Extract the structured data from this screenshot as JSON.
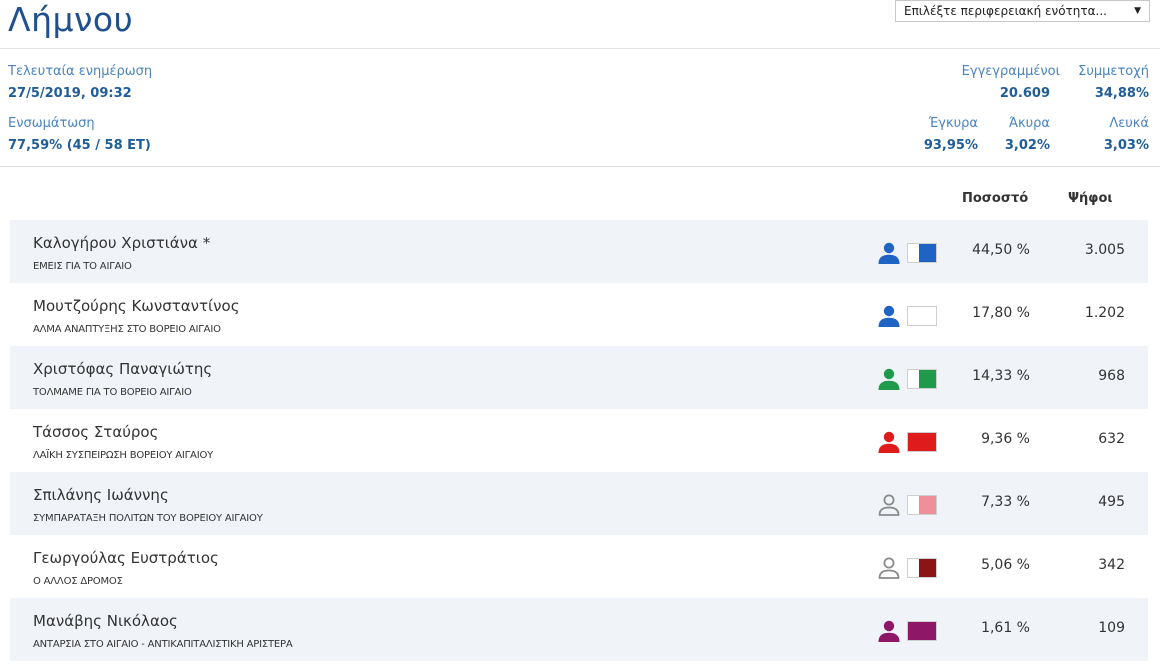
{
  "header": {
    "title": "Λήμνου",
    "region_select": {
      "value": "Επιλέξτε περιφερειακή ενότητα..."
    }
  },
  "meta": {
    "last_update_label": "Τελευταία ενημέρωση",
    "last_update_value": "27/5/2019, 09:32",
    "integration_label": "Ενσωμάτωση",
    "integration_pct": "77,59%",
    "integration_count": "(45 / 58 ΕΤ)",
    "registered_label": "Εγγεγραμμένοι",
    "registered_value": "20.609",
    "turnout_label": "Συμμετοχή",
    "turnout_value": "34,88%",
    "valid_label": "Έγκυρα",
    "valid_value": "93,95%",
    "invalid_label": "Άκυρα",
    "invalid_value": "3,02%",
    "blank_label": "Λευκά",
    "blank_value": "3,03%"
  },
  "table": {
    "col_percent": "Ποσοστό",
    "col_votes": "Ψήφοι",
    "rows": [
      {
        "name": "Καλογήρου Χριστιάνα *",
        "party": "ΕΜΕΙΣ ΓΙΑ ΤΟ ΑΙΓΑΙΟ",
        "percent": "44,50 %",
        "votes": "3.005",
        "icon": "person-filled-icon",
        "icon_color": "#1f63c4",
        "swatch_color": "#1f63c4",
        "swatch_fill": 0.6
      },
      {
        "name": "Μουτζούρης Κωνσταντίνος",
        "party": "ΑΛΜΑ ΑΝΑΠΤΥΞΗΣ ΣΤΟ ΒΟΡΕΙΟ ΑΙΓΑΙΟ",
        "percent": "17,80 %",
        "votes": "1.202",
        "icon": "person-filled-icon",
        "icon_color": "#1f63c4",
        "swatch_color": "#ffffff",
        "swatch_fill": 0.0
      },
      {
        "name": "Χριστόφας Παναγιώτης",
        "party": "ΤΟΛΜΑΜΕ ΓΙΑ ΤΟ ΒΟΡΕΙΟ ΑΙΓΑΙΟ",
        "percent": "14,33 %",
        "votes": "968",
        "icon": "person-filled-icon",
        "icon_color": "#1e9a4a",
        "swatch_color": "#1e9a4a",
        "swatch_fill": 0.6
      },
      {
        "name": "Τάσσος Σταύρος",
        "party": "ΛΑΪΚΗ ΣΥΣΠΕΙΡΩΣΗ ΒΟΡΕΙΟΥ ΑΙΓΑΙΟΥ",
        "percent": "9,36 %",
        "votes": "632",
        "icon": "person-filled-icon",
        "icon_color": "#e01b1b",
        "swatch_color": "#e01b1b",
        "swatch_fill": 1.0
      },
      {
        "name": "Σπιλάνης Ιωάννης",
        "party": "ΣΥΜΠΑΡΑΤΑΞΗ ΠΟΛΙΤΩΝ ΤΟΥ ΒΟΡΕΙΟΥ ΑΙΓΑΙΟΥ",
        "percent": "7,33 %",
        "votes": "495",
        "icon": "person-outline-icon",
        "icon_color": "#8a8a8a",
        "swatch_color": "#ef8f9a",
        "swatch_fill": 0.6
      },
      {
        "name": "Γεωργούλας Ευστράτιος",
        "party": "Ο ΑΛΛΟΣ ΔΡΟΜΟΣ",
        "percent": "5,06 %",
        "votes": "342",
        "icon": "person-outline-icon",
        "icon_color": "#8a8a8a",
        "swatch_color": "#8b1414",
        "swatch_fill": 0.6
      },
      {
        "name": "Μανάβης Νικόλαος",
        "party": "ΑΝΤΑΡΣΙΑ ΣΤΟ ΑΙΓΑΙΟ - ΑΝΤΙΚΑΠΙΤΑΛΙΣΤΙΚΗ ΑΡΙΣΤΕΡΑ",
        "percent": "1,61 %",
        "votes": "109",
        "icon": "person-filled-icon",
        "icon_color": "#8e1768",
        "swatch_color": "#8e1768",
        "swatch_fill": 1.0
      }
    ]
  }
}
